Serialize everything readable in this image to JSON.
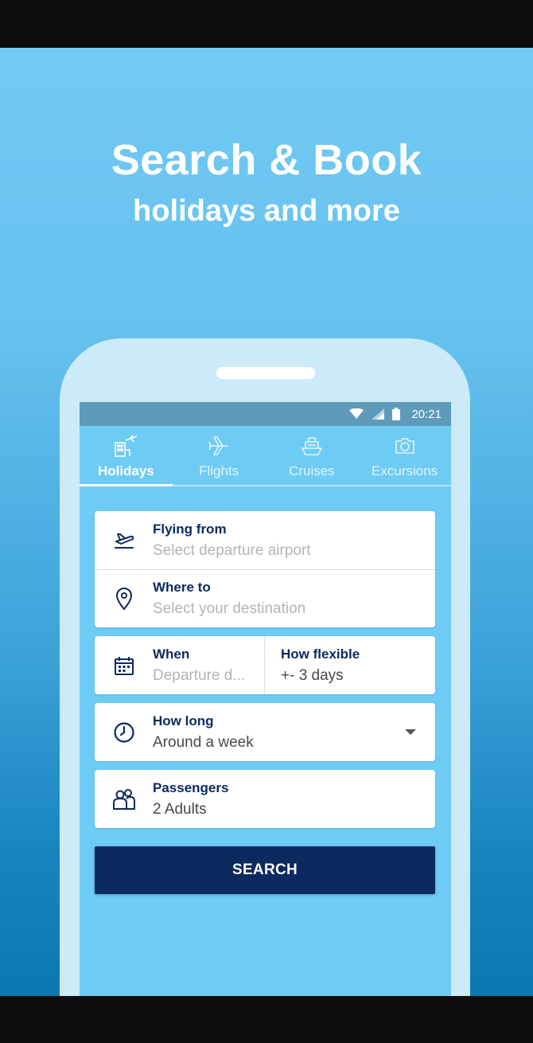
{
  "hero": {
    "title": "Search & Book",
    "subtitle": "holidays and more"
  },
  "status_bar": {
    "time": "20:21",
    "icons": [
      "wifi-icon",
      "signal-icon",
      "battery-icon"
    ]
  },
  "tabs": [
    {
      "label": "Holidays",
      "icon": "holiday-building-plane-icon",
      "active": true
    },
    {
      "label": "Flights",
      "icon": "airplane-icon",
      "active": false
    },
    {
      "label": "Cruises",
      "icon": "ship-icon",
      "active": false
    },
    {
      "label": "Excursions",
      "icon": "camera-icon",
      "active": false
    }
  ],
  "form": {
    "flying_from": {
      "label": "Flying from",
      "placeholder": "Select departure airport",
      "icon": "plane-takeoff-icon"
    },
    "where_to": {
      "label": "Where to",
      "placeholder": "Select your destination",
      "icon": "location-pin-icon"
    },
    "when": {
      "label": "When",
      "placeholder": "Departure d...",
      "icon": "calendar-icon"
    },
    "how_flexible": {
      "label": "How flexible",
      "value": "+- 3 days"
    },
    "how_long": {
      "label": "How long",
      "value": "Around a week",
      "icon": "clock-icon"
    },
    "passengers": {
      "label": "Passengers",
      "value": "2 Adults",
      "icon": "passengers-icon"
    },
    "search_label": "SEARCH"
  },
  "colors": {
    "navy": "#0c2a60",
    "sky": "#6ecbf4",
    "status_bar": "#5e9bbb",
    "placeholder": "#b4b4b4"
  }
}
